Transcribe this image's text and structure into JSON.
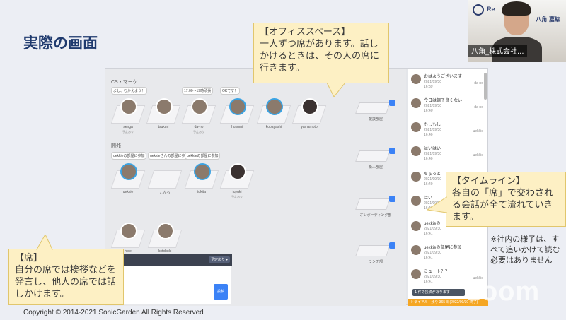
{
  "slide": {
    "title": "実際の画面",
    "copyright": "Copyright © 2014-2021 SonicGarden All Rights Reserved"
  },
  "floor": {
    "sections": [
      {
        "label": "CS・マーケ",
        "seats": [
          {
            "name": "senga",
            "status": "予定あり",
            "bubble": "よし、むかえよう！",
            "online": false
          },
          {
            "name": "tsukuri",
            "status": "",
            "bubble": "",
            "online": false
          },
          {
            "name": "da-no",
            "status": "予定あり",
            "bubble": "17:00〜19時頑張",
            "online": false
          },
          {
            "name": "hosumi",
            "status": "",
            "bubble": "OKです！",
            "online": true
          },
          {
            "name": "kobayashi",
            "status": "",
            "bubble": "",
            "online": true
          },
          {
            "name": "yamamoto",
            "status": "",
            "bubble": "",
            "online": false
          }
        ]
      },
      {
        "label": "開発",
        "seats": [
          {
            "name": "uekkie",
            "status": "",
            "bubble": "uekkieの部屋に参加",
            "online": true
          },
          {
            "name": "こんち",
            "status": "",
            "bubble": "uekkieさんの部屋に参加",
            "online": false
          },
          {
            "name": "tokita",
            "status": "",
            "bubble": "uekkieの部屋に参加",
            "online": true
          },
          {
            "name": "fuyuki",
            "status": "予定あり",
            "bubble": "",
            "online": false
          }
        ]
      },
      {
        "label": "",
        "seats": [
          {
            "name": "hide",
            "status": "",
            "bubble": "",
            "online": false
          },
          {
            "name": "kotobuki",
            "status": "",
            "bubble": "",
            "online": false
          }
        ]
      }
    ],
    "rooms": [
      "雑談部屋",
      "新人部屋",
      "オンボーディング部",
      "ランチ部"
    ]
  },
  "composer": {
    "schedule_label": "予定あり ▾",
    "send_label": "投稿"
  },
  "timeline": {
    "items": [
      {
        "text": "おはようございます",
        "date": "2021/09/30",
        "time": "16:39",
        "reply": "da-no"
      },
      {
        "text": "今日は調子良くない",
        "date": "2021/09/30",
        "time": "16:40",
        "reply": "da-no"
      },
      {
        "text": "もしもし",
        "date": "2021/09/30",
        "time": "16:40",
        "reply": "uekkie"
      },
      {
        "text": "はいはい",
        "date": "2021/09/30",
        "time": "16:40",
        "reply": "uekkie"
      },
      {
        "text": "ちょっと",
        "date": "2021/09/30",
        "time": "16:40",
        "reply": ""
      },
      {
        "text": "はい",
        "date": "2021/09/30",
        "time": "16:41",
        "reply": ""
      },
      {
        "text": "uekkieの",
        "date": "2021/09/30",
        "time": "16:41",
        "reply": ""
      },
      {
        "text": "uekkieの部屋に参加",
        "date": "2021/09/30",
        "time": "16:41",
        "reply": ""
      },
      {
        "text": "ミュート？？",
        "date": "2021/09/30",
        "time": "16:41",
        "reply": "uekkie"
      }
    ],
    "banner": "1 件の投稿があります",
    "footer": "トライアル · 残り 365日 (2022/09/30 終了)"
  },
  "callouts": {
    "office": {
      "title": "【オフィススペース】",
      "body": "一人ずつ席があります。話しかけるときは、その人の席に行きます。"
    },
    "timeline": {
      "title": "【タイムライン】",
      "body": "各自の「席」で交わされる会話が全て流れていきます。"
    },
    "seat": {
      "title": "【席】",
      "body": "自分の席では挨拶などを発言し、他人の席では話しかけます。"
    }
  },
  "note": "※社内の様子は、すべて追いかけて読む必要はありません",
  "video": {
    "participant_name": "八角_株式会社...",
    "logo_text": "Re",
    "sign_text": "八角 嘉紘"
  },
  "watermark": "zoom"
}
